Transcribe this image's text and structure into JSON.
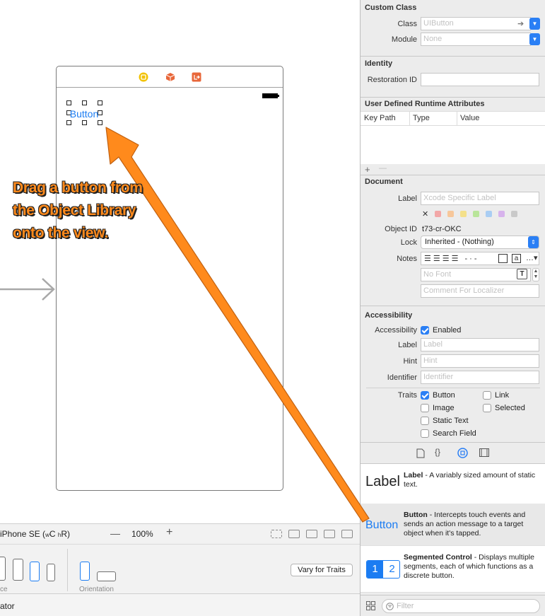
{
  "canvas": {
    "button_label": "Button",
    "colors": {
      "button_text": "#1b7cf2"
    }
  },
  "canvas_bar": {
    "device": "iPhone SE",
    "size_class_w": "w",
    "size_class_c": "C",
    "size_class_h": "h",
    "size_class_r": "R",
    "zoom_out": "—",
    "zoom": "100%",
    "zoom_in": "+"
  },
  "device_bar": {
    "device_label": "ce",
    "orientation_label": "Orientation",
    "vary_button": "Vary for Traits"
  },
  "status_bar": {
    "text": "ator"
  },
  "inspector": {
    "custom_class": {
      "title": "Custom Class",
      "class_label": "Class",
      "class_placeholder": "UIButton",
      "module_label": "Module",
      "module_placeholder": "None"
    },
    "identity": {
      "title": "Identity",
      "restoration_label": "Restoration ID"
    },
    "runtime": {
      "title": "User Defined Runtime Attributes",
      "col_key": "Key Path",
      "col_type": "Type",
      "col_value": "Value",
      "add": "+",
      "remove": "—"
    },
    "document": {
      "title": "Document",
      "label_label": "Label",
      "label_placeholder": "Xcode Specific Label",
      "clear_color": "✕",
      "swatches": [
        "#f2a7a7",
        "#f7c79a",
        "#f4e08a",
        "#b9e59a",
        "#a9cdf3",
        "#d7b3ec",
        "#c9c9c9"
      ],
      "object_id_label": "Object ID",
      "object_id": "t73-cr-OKC",
      "lock_label": "Lock",
      "lock_value": "Inherited - (Nothing)",
      "notes_label": "Notes",
      "font_placeholder": "No Font",
      "comment_placeholder": "Comment For Localizer"
    },
    "accessibility": {
      "title": "Accessibility",
      "accessibility_label": "Accessibility",
      "enabled": "Enabled",
      "label_label": "Label",
      "label_placeholder": "Label",
      "hint_label": "Hint",
      "hint_placeholder": "Hint",
      "identifier_label": "Identifier",
      "identifier_placeholder": "Identifier",
      "traits_label": "Traits",
      "traits": {
        "button": "Button",
        "link": "Link",
        "image": "Image",
        "selected": "Selected",
        "static_text": "Static Text",
        "search_field": "Search Field"
      }
    },
    "library": {
      "label_item": {
        "icon": "Label",
        "name": "Label",
        "desc": " - A variably sized amount of static text."
      },
      "button_item": {
        "icon": "Button",
        "name": "Button",
        "desc": " - Intercepts touch events and sends an action message to a target object when it's tapped."
      },
      "segmented_item": {
        "seg1": "1",
        "seg2": "2",
        "name": "Segmented Control",
        "desc": " - Displays multiple segments, each of which functions as a discrete button."
      },
      "filter_placeholder": "Filter"
    },
    "colors": {
      "accent": "#2a7ff5"
    }
  },
  "annotation": {
    "text": "Drag a button from the Object Library onto the view.",
    "colors": {
      "fill": "#ff8a1c",
      "stroke": "#222222"
    }
  }
}
